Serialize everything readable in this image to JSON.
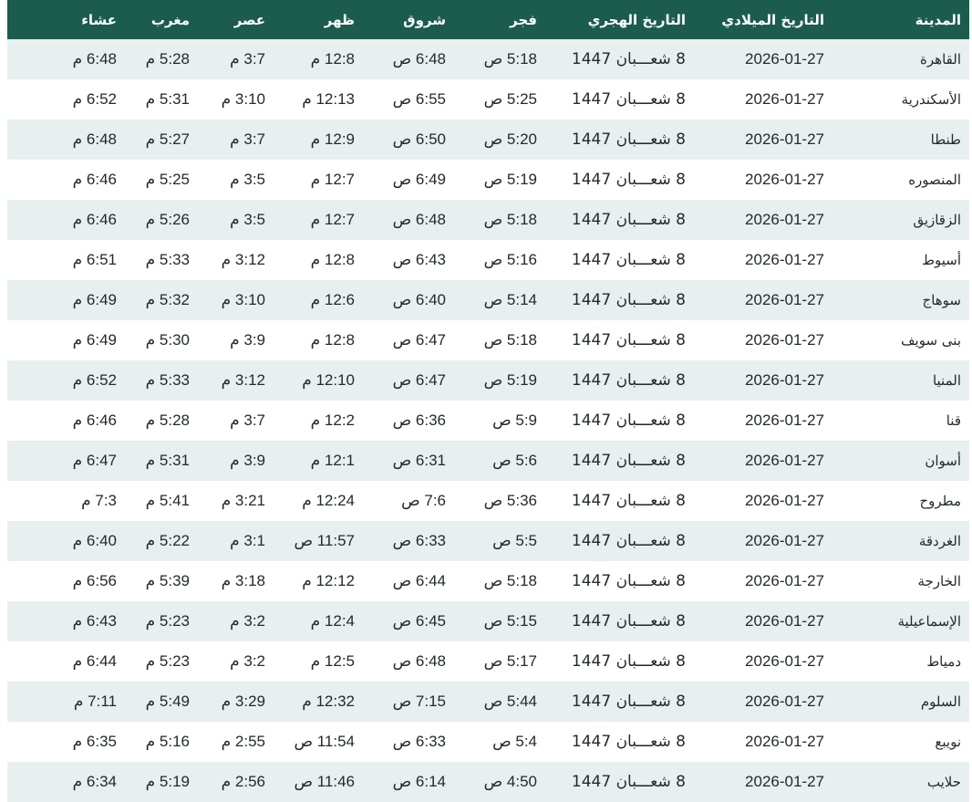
{
  "headers": [
    "المدينة",
    "التاريخ الميلادي",
    "التاريخ الهجري",
    "فجر",
    "شروق",
    "ظهر",
    "عصر",
    "مغرب",
    "عشاء"
  ],
  "colors": {
    "header_bg": "#1c5c4e",
    "row_alt_bg": "#e8efef",
    "header_text": "#ffffff"
  },
  "rows": [
    [
      "القاهرة",
      "2026-01-27",
      "8 شعـــبان 1447",
      "5:18 ص",
      "6:48 ص",
      "12:8 م",
      "3:7 م",
      "5:28 م",
      "6:48 م"
    ],
    [
      "الأسكندرية",
      "2026-01-27",
      "8 شعـــبان 1447",
      "5:25 ص",
      "6:55 ص",
      "12:13 م",
      "3:10 م",
      "5:31 م",
      "6:52 م"
    ],
    [
      "طنطا",
      "2026-01-27",
      "8 شعـــبان 1447",
      "5:20 ص",
      "6:50 ص",
      "12:9 م",
      "3:7 م",
      "5:27 م",
      "6:48 م"
    ],
    [
      "المنصوره",
      "2026-01-27",
      "8 شعـــبان 1447",
      "5:19 ص",
      "6:49 ص",
      "12:7 م",
      "3:5 م",
      "5:25 م",
      "6:46 م"
    ],
    [
      "الزقازيق",
      "2026-01-27",
      "8 شعـــبان 1447",
      "5:18 ص",
      "6:48 ص",
      "12:7 م",
      "3:5 م",
      "5:26 م",
      "6:46 م"
    ],
    [
      "أسيوط",
      "2026-01-27",
      "8 شعـــبان 1447",
      "5:16 ص",
      "6:43 ص",
      "12:8 م",
      "3:12 م",
      "5:33 م",
      "6:51 م"
    ],
    [
      "سوهاج",
      "2026-01-27",
      "8 شعـــبان 1447",
      "5:14 ص",
      "6:40 ص",
      "12:6 م",
      "3:10 م",
      "5:32 م",
      "6:49 م"
    ],
    [
      "بنى سويف",
      "2026-01-27",
      "8 شعـــبان 1447",
      "5:18 ص",
      "6:47 ص",
      "12:8 م",
      "3:9 م",
      "5:30 م",
      "6:49 م"
    ],
    [
      "المنيا",
      "2026-01-27",
      "8 شعـــبان 1447",
      "5:19 ص",
      "6:47 ص",
      "12:10 م",
      "3:12 م",
      "5:33 م",
      "6:52 م"
    ],
    [
      "قنا",
      "2026-01-27",
      "8 شعـــبان 1447",
      "5:9 ص",
      "6:36 ص",
      "12:2 م",
      "3:7 م",
      "5:28 م",
      "6:46 م"
    ],
    [
      "أسوان",
      "2026-01-27",
      "8 شعـــبان 1447",
      "5:6 ص",
      "6:31 ص",
      "12:1 م",
      "3:9 م",
      "5:31 م",
      "6:47 م"
    ],
    [
      "مطروح",
      "2026-01-27",
      "8 شعـــبان 1447",
      "5:36 ص",
      "7:6 ص",
      "12:24 م",
      "3:21 م",
      "5:41 م",
      "7:3 م"
    ],
    [
      "الغردقة",
      "2026-01-27",
      "8 شعـــبان 1447",
      "5:5 ص",
      "6:33 ص",
      "11:57 ص",
      "3:1 م",
      "5:22 م",
      "6:40 م"
    ],
    [
      "الخارجة",
      "2026-01-27",
      "8 شعـــبان 1447",
      "5:18 ص",
      "6:44 ص",
      "12:12 م",
      "3:18 م",
      "5:39 م",
      "6:56 م"
    ],
    [
      "الإسماعيلية",
      "2026-01-27",
      "8 شعـــبان 1447",
      "5:15 ص",
      "6:45 ص",
      "12:4 م",
      "3:2 م",
      "5:23 م",
      "6:43 م"
    ],
    [
      "دمياط",
      "2026-01-27",
      "8 شعـــبان 1447",
      "5:17 ص",
      "6:48 ص",
      "12:5 م",
      "3:2 م",
      "5:23 م",
      "6:44 م"
    ],
    [
      "السلوم",
      "2026-01-27",
      "8 شعـــبان 1447",
      "5:44 ص",
      "7:15 ص",
      "12:32 م",
      "3:29 م",
      "5:49 م",
      "7:11 م"
    ],
    [
      "نويبع",
      "2026-01-27",
      "8 شعـــبان 1447",
      "5:4 ص",
      "6:33 ص",
      "11:54 ص",
      "2:55 م",
      "5:16 م",
      "6:35 م"
    ],
    [
      "حلايب",
      "2026-01-27",
      "8 شعـــبان 1447",
      "4:50 ص",
      "6:14 ص",
      "11:46 ص",
      "2:56 م",
      "5:19 م",
      "6:34 م"
    ]
  ]
}
